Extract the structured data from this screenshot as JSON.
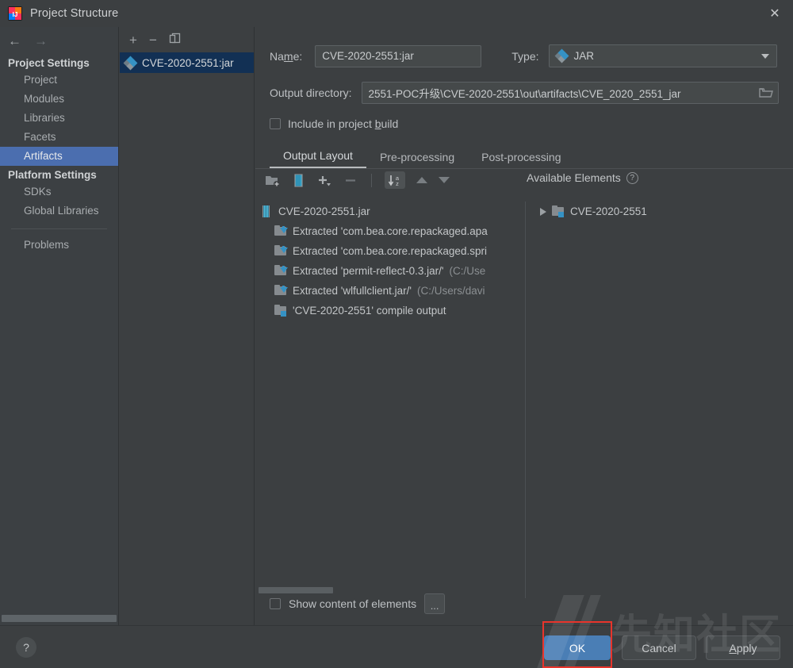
{
  "window": {
    "title": "Project Structure",
    "app_icon": "intellij-idea-logo",
    "close_icon": "✕"
  },
  "sidebar": {
    "back_icon": "←",
    "forward_icon": "→",
    "groups": [
      {
        "title": "Project Settings",
        "items": [
          {
            "label": "Project",
            "selected": false
          },
          {
            "label": "Modules",
            "selected": false
          },
          {
            "label": "Libraries",
            "selected": false
          },
          {
            "label": "Facets",
            "selected": false
          },
          {
            "label": "Artifacts",
            "selected": true
          }
        ]
      },
      {
        "title": "Platform Settings",
        "items": [
          {
            "label": "SDKs",
            "selected": false
          },
          {
            "label": "Global Libraries",
            "selected": false
          }
        ]
      }
    ],
    "problems_label": "Problems"
  },
  "artifact_panel": {
    "toolbar": {
      "add_icon": "+",
      "remove_icon": "−",
      "copy_icon": "❐"
    },
    "items": [
      {
        "label": "CVE-2020-2551:jar",
        "icon": "jar-artifact-icon",
        "selected": true
      }
    ]
  },
  "form": {
    "name_label_pre": "Na",
    "name_label_key": "m",
    "name_label_post": "e:",
    "name_label": "Name:",
    "name_value": "CVE-2020-2551:jar",
    "type_label": "Type:",
    "type_value": "JAR",
    "type_icon": "jar-artifact-icon",
    "output_label": "Output directory:",
    "output_value": "2551-POC升级\\CVE-2020-2551\\out\\artifacts\\CVE_2020_2551_jar",
    "browse_icon": "folder-browse-icon",
    "include_label_pre": "Include in project ",
    "include_label_key": "b",
    "include_label_post": "uild",
    "include_label": "Include in project build",
    "include_checked": false
  },
  "tabs": [
    {
      "label": "Output Layout",
      "active": true
    },
    {
      "label": "Pre-processing",
      "active": false
    },
    {
      "label": "Post-processing",
      "active": false
    }
  ],
  "tree_toolbar": {
    "create_directory_icon": "add-folder-icon",
    "create_archive_icon": "add-archive-icon",
    "add_icon": "+",
    "remove_icon": "−",
    "sort_icon": "sort-az-icon",
    "sort_label_a": "a",
    "sort_label_z": "z",
    "move_up_icon": "arrow-up-icon",
    "move_down_icon": "arrow-down-icon",
    "available_elements_label": "Available Elements",
    "help_icon": "?"
  },
  "output_tree": [
    {
      "indent": 0,
      "icon": "jar-file-icon",
      "text": "CVE-2020-2551.jar",
      "suffix": ""
    },
    {
      "indent": 1,
      "icon": "extracted-icon",
      "text": "Extracted 'com.bea.core.repackaged.apa",
      "suffix": ""
    },
    {
      "indent": 1,
      "icon": "extracted-icon",
      "text": "Extracted 'com.bea.core.repackaged.spri",
      "suffix": ""
    },
    {
      "indent": 1,
      "icon": "extracted-icon",
      "text": "Extracted 'permit-reflect-0.3.jar/'",
      "suffix": "(C:/Use"
    },
    {
      "indent": 1,
      "icon": "extracted-icon",
      "text": "Extracted 'wlfullclient.jar/'",
      "suffix": "(C:/Users/davi"
    },
    {
      "indent": 1,
      "icon": "compile-output-icon",
      "text": "'CVE-2020-2551' compile output",
      "suffix": ""
    }
  ],
  "available_tree": [
    {
      "icon": "compile-output-icon",
      "text": "CVE-2020-2551",
      "expander": "▶"
    }
  ],
  "bottom": {
    "show_content_label": "Show content of elements",
    "show_content_checked": false,
    "ellipsis_label": "..."
  },
  "footer": {
    "help_icon": "?",
    "ok_label": "OK",
    "cancel_label": "Cancel",
    "apply_label_pre": "",
    "apply_label_key": "A",
    "apply_label_post": "pply",
    "apply_label": "Apply"
  },
  "overlay": {
    "watermark_text": "先知社区",
    "annotation_color": "#e8342b"
  },
  "colors": {
    "accent_blue": "#4a7eb5",
    "selection_blue": "#4b6eaf",
    "list_selection": "#123054",
    "background": "#3c3f41",
    "sidebar_background": "#3c4043",
    "icon_blue": "#3592c4"
  }
}
